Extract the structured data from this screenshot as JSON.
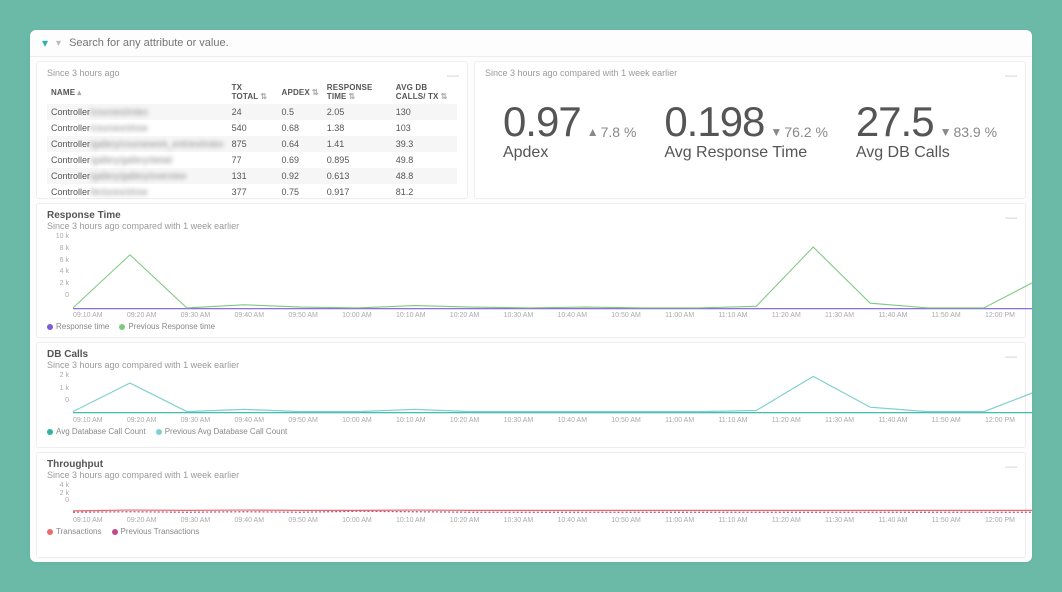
{
  "search": {
    "placeholder": "Search for any attribute or value."
  },
  "table": {
    "subtitle": "Since 3 hours ago",
    "headers": [
      "NAME",
      "TX TOTAL",
      "APDEX",
      "RESPONSE TIME",
      "AVG DB CALLS/ TX"
    ],
    "rows": [
      {
        "name": "Controller",
        "blur": "/courses/index",
        "tx": "24",
        "apdex": "0.5",
        "rt": "2.05",
        "db": "130"
      },
      {
        "name": "Controller",
        "blur": "/courses/show",
        "tx": "540",
        "apdex": "0.68",
        "rt": "1.38",
        "db": "103"
      },
      {
        "name": "Controller",
        "blur": "/gallery/coursework_entries/index",
        "tx": "875",
        "apdex": "0.64",
        "rt": "1.41",
        "db": "39.3"
      },
      {
        "name": "Controller",
        "blur": "/gallery/gallery/detail",
        "tx": "77",
        "apdex": "0.69",
        "rt": "0.895",
        "db": "49.8"
      },
      {
        "name": "Controller",
        "blur": "/gallery/gallery/overview",
        "tx": "131",
        "apdex": "0.92",
        "rt": "0.613",
        "db": "48.8"
      },
      {
        "name": "Controller",
        "blur": "/lectures/show",
        "tx": "377",
        "apdex": "0.75",
        "rt": "0.917",
        "db": "81.2"
      }
    ]
  },
  "metrics_subtitle": "Since 3 hours ago compared with 1 week earlier",
  "metrics": {
    "apdex": {
      "value": "0.97",
      "delta": "7.8 %",
      "dir": "up",
      "label": "Apdex"
    },
    "avg_rt": {
      "value": "0.198",
      "delta": "76.2 %",
      "dir": "down",
      "label": "Avg Response Time"
    },
    "avg_db": {
      "value": "27.5",
      "delta": "83.9 %",
      "dir": "down",
      "label": "Avg DB Calls"
    }
  },
  "charts": {
    "response_time": {
      "title": "Response Time",
      "subtitle": "Since 3 hours ago compared with 1 week earlier",
      "legend": [
        "Response time",
        "Previous Response time"
      ],
      "colors": [
        "#7b5cd6",
        "#7fc97f"
      ]
    },
    "db_calls": {
      "title": "DB Calls",
      "subtitle": "Since 3 hours ago compared with 1 week earlier",
      "legend": [
        "Avg Database Call Count",
        "Previous Avg Database Call Count"
      ],
      "colors": [
        "#2bb3a3",
        "#7fd0d0"
      ]
    },
    "throughput": {
      "title": "Throughput",
      "subtitle": "Since 3 hours ago compared with 1 week earlier",
      "legend": [
        "Transactions",
        "Previous Transactions"
      ],
      "colors": [
        "#e86c6c",
        "#c04a8a"
      ]
    }
  },
  "chart_data": [
    {
      "type": "line",
      "title": "Response Time",
      "xlabel": "",
      "ylabel": "",
      "ylim": [
        0,
        10000
      ],
      "yticks": [
        "10 k",
        "8 k",
        "6 k",
        "4 k",
        "2 k",
        "0"
      ],
      "x": [
        "09:10 AM",
        "09:20 AM",
        "09:30 AM",
        "09:40 AM",
        "09:50 AM",
        "10:00 AM",
        "10:10 AM",
        "10:20 AM",
        "10:30 AM",
        "10:40 AM",
        "10:50 AM",
        "11:00 AM",
        "11:10 AM",
        "11:20 AM",
        "11:30 AM",
        "11:40 AM",
        "11:50 AM",
        "12:00 PM"
      ],
      "series": [
        {
          "name": "Response time",
          "values": [
            300,
            300,
            300,
            300,
            300,
            300,
            300,
            300,
            300,
            300,
            300,
            300,
            300,
            300,
            300,
            300,
            300,
            300
          ]
        },
        {
          "name": "Previous Response time",
          "values": [
            400,
            7200,
            400,
            800,
            500,
            400,
            700,
            500,
            400,
            500,
            400,
            400,
            600,
            8200,
            1000,
            400,
            400,
            4200
          ]
        }
      ]
    },
    {
      "type": "line",
      "title": "DB Calls",
      "ylim": [
        0,
        2000
      ],
      "yticks": [
        "2 k",
        "1 k",
        "0"
      ],
      "x": [
        "09:10 AM",
        "09:20 AM",
        "09:30 AM",
        "09:40 AM",
        "09:50 AM",
        "10:00 AM",
        "10:10 AM",
        "10:20 AM",
        "10:30 AM",
        "10:40 AM",
        "10:50 AM",
        "11:00 AM",
        "11:10 AM",
        "11:20 AM",
        "11:30 AM",
        "11:40 AM",
        "11:50 AM",
        "12:00 PM"
      ],
      "series": [
        {
          "name": "Avg Database Call Count",
          "values": [
            150,
            150,
            150,
            150,
            150,
            150,
            150,
            150,
            150,
            150,
            150,
            150,
            150,
            150,
            150,
            150,
            150,
            150
          ]
        },
        {
          "name": "Previous Avg Database Call Count",
          "values": [
            200,
            1500,
            200,
            300,
            200,
            200,
            300,
            200,
            200,
            200,
            200,
            200,
            250,
            1800,
            400,
            200,
            200,
            1200
          ]
        }
      ]
    },
    {
      "type": "line",
      "title": "Throughput",
      "ylim": [
        0,
        4000
      ],
      "yticks": [
        "4 k",
        "2 k",
        "0"
      ],
      "x": [
        "09:10 AM",
        "09:20 AM",
        "09:30 AM",
        "09:40 AM",
        "09:50 AM",
        "10:00 AM",
        "10:10 AM",
        "10:20 AM",
        "10:30 AM",
        "10:40 AM",
        "10:50 AM",
        "11:00 AM",
        "11:10 AM",
        "11:20 AM",
        "11:30 AM",
        "11:40 AM",
        "11:50 AM",
        "12:00 PM"
      ],
      "series": [
        {
          "name": "Transactions",
          "values": [
            600,
            700,
            650,
            700,
            650,
            650,
            700,
            650,
            650,
            650,
            650,
            650,
            650,
            650,
            650,
            650,
            650,
            650
          ]
        },
        {
          "name": "Previous Transactions",
          "values": [
            450,
            500,
            450,
            500,
            450,
            550,
            500,
            450,
            450,
            450,
            450,
            450,
            450,
            450,
            450,
            450,
            450,
            450
          ]
        }
      ]
    }
  ]
}
